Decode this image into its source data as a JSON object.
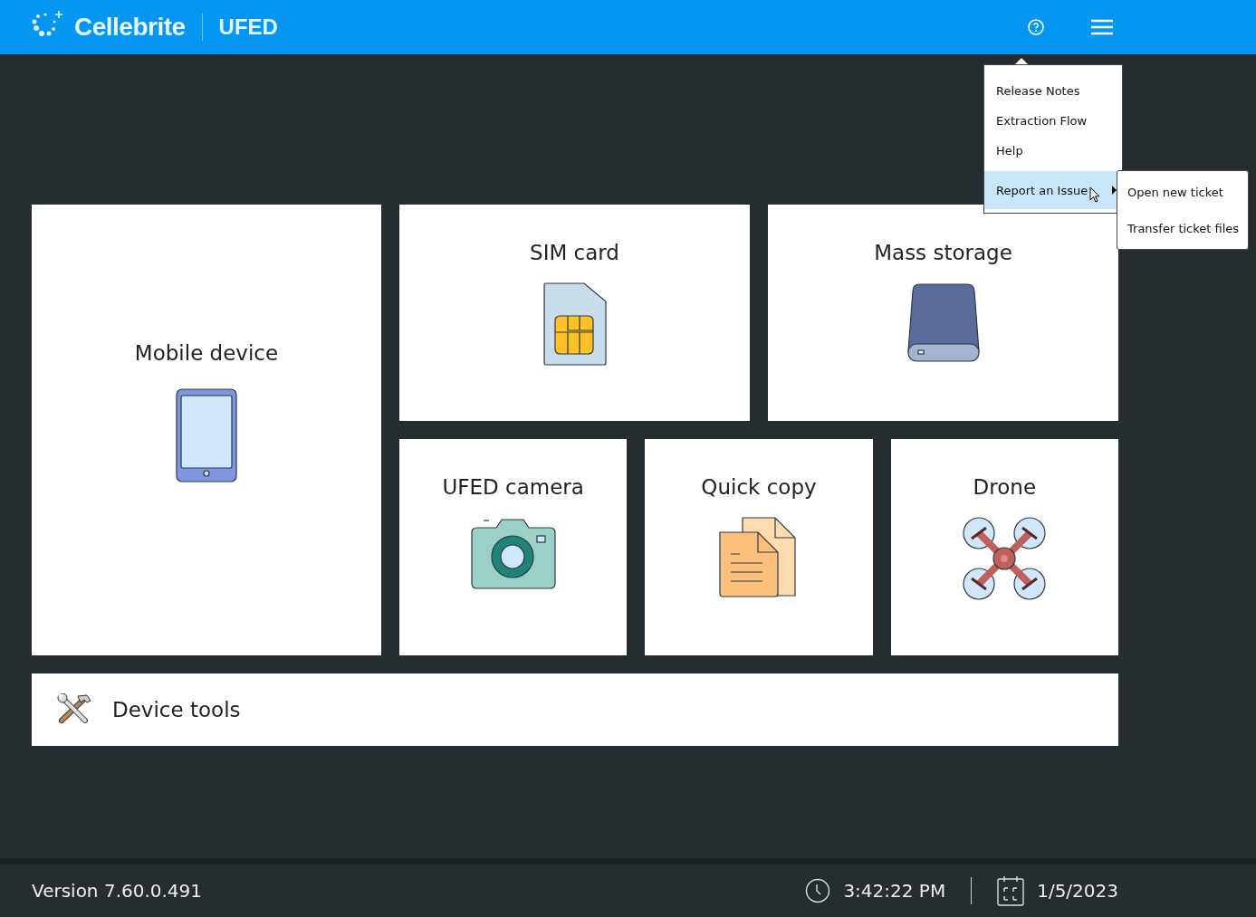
{
  "header": {
    "brand": "Cellebrite",
    "product": "UFED"
  },
  "menu": {
    "items": [
      {
        "label": "Release Notes",
        "selected": false,
        "submenu": false
      },
      {
        "label": "Extraction Flow",
        "selected": false,
        "submenu": false
      },
      {
        "label": "Help",
        "selected": false,
        "submenu": false
      },
      {
        "label": "Report an Issue",
        "selected": true,
        "submenu": true
      }
    ],
    "submenu": [
      "Open new ticket",
      "Transfer ticket files"
    ]
  },
  "tiles": [
    {
      "label": "Mobile device",
      "kind": "mobile"
    },
    {
      "label": "SIM card",
      "kind": "sim"
    },
    {
      "label": "Mass storage",
      "kind": "storage"
    },
    {
      "label": "UFED camera",
      "kind": "camera"
    },
    {
      "label": "Quick copy",
      "kind": "copy"
    },
    {
      "label": "Drone",
      "kind": "drone"
    }
  ],
  "tools": {
    "label": "Device tools"
  },
  "status_bar": {
    "version": "Version 7.60.0.491",
    "time": "3:42:22 PM",
    "date": "1/5/2023"
  }
}
